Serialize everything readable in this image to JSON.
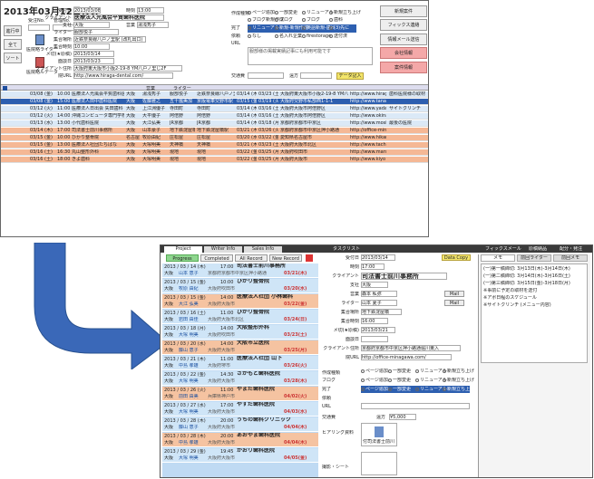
{
  "top": {
    "date": "2013年03月12日(火)",
    "side_buttons": [
      "進行中",
      "全て",
      "ソート"
    ],
    "user_labels": [
      "受注No.",
      "管理No."
    ],
    "icon_labels": [
      "医院略ライター",
      "医院略ルデータ"
    ],
    "fields": [
      {
        "label": "受付日",
        "value": "2013/03/08"
      },
      {
        "label": "時刻",
        "value": "13:00"
      },
      {
        "label": "クライアント",
        "value": "医療法人光風会平賀歯科医院"
      },
      {
        "label": "支社",
        "value": "大阪"
      },
      {
        "label": "営業",
        "value": "湯浅秀子"
      },
      {
        "label": "ライター",
        "value": "服部悦子"
      },
      {
        "label": "集合場所",
        "value": "近鉄奈良線八戸ノ里駅 (改札出口)"
      },
      {
        "label": "集合時刻",
        "value": "10:00"
      },
      {
        "label": "メ切(★原稿)",
        "value": "2013/03/14"
      },
      {
        "label": "面談日",
        "value": "2013/03/23"
      },
      {
        "label": "クライアント住所",
        "value": "大阪府東大阪市小阪2-19-8 YM八戸ノ里じ2F"
      },
      {
        "label": "院URL",
        "value": "http://www.hiraga-dental.com/"
      }
    ],
    "sakusei_label": "作成種類",
    "checkbox_rows": [
      [
        "ページ追加",
        "一部変更",
        "リニューアル",
        "新規立ち上げ"
      ],
      [
        "ブログ新規作成",
        "ブログ",
        "ブログ",
        "歯科"
      ],
      [
        "リニューアル",
        "新規-新規作成",
        "英語新規-歯科",
        "(3)先に"
      ],
      [
        "なし",
        "名入れ企業",
        "firestorage",
        "送付済"
      ]
    ],
    "mid_labels": [
      "完了",
      "依頼",
      "URL"
    ],
    "koutsuuhi": "交通費",
    "tax_label": "遠方",
    "date_btn": "データ記入",
    "note": "服部様の掲載実績記事にも利用可能です",
    "right_buttons": [
      "新規案件",
      "フィックス連絡",
      "情報メール送信",
      "会社情報",
      "案件情報"
    ]
  },
  "grid": {
    "headers": [
      "",
      "営業",
      "ライター"
    ],
    "rows": [
      {
        "date": "03/08 (金)",
        "time": "10:00",
        "client": "医療法人光風会平賀歯科医院",
        "shisha": "大阪",
        "eigyo": "湯浅秀子",
        "writer": "服部悦子",
        "place": "近鉄奈良線八戸ノ里",
        "d1": "03/14 (木)",
        "d2": "03/23 (土)",
        "addr": "大阪府東大阪市小阪2-19-8 YM八戸",
        "url": "http://www.hiraga",
        "note": "歯科医院様の取材",
        "c": "blue"
      },
      {
        "date": "03/08 (金)",
        "time": "15:00",
        "client": "医療法人田中歯科医院",
        "shisha": "大阪",
        "eigyo": "佐藤雅之",
        "writer": "五十嵐美加",
        "place": "京阪電車交野市駅",
        "d1": "03/15 (金)",
        "d2": "03/19 (火)",
        "addr": "大阪府交野市私部西1-1-1",
        "url": "http://www.tanaka",
        "note": "",
        "c": "sel"
      },
      {
        "date": "03/12 (火)",
        "time": "11:00",
        "client": "医療法人日出会 矢田歯科",
        "shisha": "大阪",
        "eigyo": "上江洲優子",
        "writer": "寺田町",
        "place": "寺田町",
        "d1": "03/14 (木)",
        "d2": "03/16 (土)",
        "addr": "大阪府大阪市阿倍野区",
        "url": "http://www.yada",
        "note": "サイトクリンチ",
        "c": "blue"
      },
      {
        "date": "03/12 (火)",
        "time": "14:00",
        "client": "沖縄コンピュータ専門学校",
        "shisha": "大阪",
        "eigyo": "大平優子",
        "writer": "阿倍野",
        "place": "阿倍野",
        "d1": "03/14 (木)",
        "d2": "03/16 (土)",
        "addr": "大阪府大阪市阿倍野区",
        "url": "http://www.okinawa",
        "note": "",
        "c": "blue"
      },
      {
        "date": "03/13 (水)",
        "time": "13:00",
        "client": "小代歯科医院",
        "shisha": "大阪",
        "eigyo": "大江弘美",
        "writer": "JR京都",
        "place": "JR京都",
        "d1": "03/14 (木)",
        "d2": "03/18 (月)",
        "addr": "京都府京都市中京区",
        "url": "http://www.moshiro",
        "note": "最後の医院",
        "c": "blue"
      },
      {
        "date": "03/14 (木)",
        "time": "17:00",
        "client": "司法書士前川事務所",
        "shisha": "大阪",
        "eigyo": "山本豪子",
        "writer": "地下鉄淀屋橋駅",
        "place": "地下鉄淀屋橋駅",
        "d1": "03/21 (木)",
        "d2": "03/26 (火)",
        "addr": "京都府京都市中京区押小路通",
        "url": "http://office-mina",
        "note": "",
        "c": "orange"
      },
      {
        "date": "03/15 (金)",
        "time": "10:00",
        "client": "ひかり整骨院",
        "shisha": "名古屋",
        "eigyo": "牧原由紀",
        "writer": "庄松屋",
        "place": "庄松屋",
        "d1": "03/20 (水)",
        "d2": "03/22 (金)",
        "addr": "愛知県名古屋市",
        "url": "http://www.hikari",
        "note": "",
        "c": "orange"
      },
      {
        "date": "03/15 (金)",
        "time": "13:00",
        "client": "医療法人社団たちばな",
        "shisha": "大阪",
        "eigyo": "大塚明美",
        "writer": "天神橋",
        "place": "天神橋",
        "d1": "03/21 (木)",
        "d2": "03/23 (土)",
        "addr": "大阪府大阪市北区",
        "url": "http://www.tachib",
        "note": "",
        "c": "orange"
      },
      {
        "date": "03/16 (土)",
        "time": "16:30",
        "client": "丸山整形外科",
        "shisha": "大阪",
        "eigyo": "大塚明美",
        "writer": "現地",
        "place": "現地",
        "d1": "03/22 (金)",
        "d2": "03/25 (月)",
        "addr": "大阪府吹田市",
        "url": "http://www.maruy",
        "note": "",
        "c": "orange"
      },
      {
        "date": "03/16 (土)",
        "time": "18:00",
        "client": "きよ歯科",
        "shisha": "大阪",
        "eigyo": "大塚明美",
        "writer": "現地",
        "place": "現地",
        "d1": "03/22 (金)",
        "d2": "03/25 (月)",
        "addr": "大阪府大阪市",
        "url": "http://www.kiyo",
        "note": "",
        "c": "orange"
      }
    ]
  },
  "bottom": {
    "tabs": [
      "Project",
      "Writer Info",
      "Sales Info"
    ],
    "filters": [
      "Progress",
      "Completed",
      "All Record",
      "New Record"
    ],
    "list": [
      {
        "date": "2013 / 03 / 14 (木)",
        "time": "17:00",
        "name": "司法書士前川事務所",
        "s": "大阪",
        "p": "山本 恵子",
        "a": "京都府京都市中京区押小路通",
        "d": "03/21(木)"
      },
      {
        "date": "2013 / 03 / 15 (金)",
        "time": "10:00",
        "name": "ひかり整骨院",
        "s": "大阪",
        "p": "牧原 由紀",
        "a": "大阪府吹田市",
        "d": "03/20(水)"
      },
      {
        "date": "2013 / 03 / 15 (金)",
        "time": "14:00",
        "name": "医療法人社団 小林歯科",
        "s": "大阪",
        "p": "大江 弘美",
        "a": "大阪府大阪市",
        "d": "03/22(金)"
      },
      {
        "date": "2013 / 03 / 16 (土)",
        "time": "11:00",
        "name": "ひかり整骨院",
        "s": "大阪",
        "p": "岩田 由佳",
        "a": "大阪府大阪市北区",
        "d": "03/24(日)"
      },
      {
        "date": "2013 / 03 / 18 (月)",
        "time": "14:00",
        "name": "大阪整形外科",
        "s": "大阪",
        "p": "大塚 明美",
        "a": "大阪府吹田市",
        "d": "03/23(土)"
      },
      {
        "date": "2013 / 03 / 20 (水)",
        "time": "14:00",
        "name": "大阪市立医院",
        "s": "大阪",
        "p": "藤山 恵子",
        "a": "大阪府大阪市",
        "d": "03/25(月)"
      },
      {
        "date": "2013 / 03 / 21 (木)",
        "time": "11:00",
        "name": "医療法人社団 山下",
        "s": "大阪",
        "p": "中島 孝雄",
        "a": "大阪府堺市",
        "d": "03/26(火)"
      },
      {
        "date": "2013 / 03 / 22 (金)",
        "time": "14:30",
        "name": "さかもと歯科医院",
        "s": "大阪",
        "p": "大塚 明美",
        "a": "大阪府大阪市",
        "d": "03/28(木)"
      },
      {
        "date": "2013 / 03 / 26 (火)",
        "time": "11:00",
        "name": "やまだ歯科医院",
        "s": "大阪",
        "p": "前田 由美",
        "a": "兵庫県神戸市",
        "d": "04/02(火)"
      },
      {
        "date": "2013 / 03 / 27 (水)",
        "time": "17:00",
        "name": "やすだ歯科医院",
        "s": "大阪",
        "p": "大塚 明美",
        "a": "大阪府大阪市",
        "d": "04/03(水)"
      },
      {
        "date": "2013 / 03 / 28 (木)",
        "time": "20:00",
        "name": "うちの歯科クリニック",
        "s": "大阪",
        "p": "藤山 恵子",
        "a": "大阪府大阪市",
        "d": "04/04(木)"
      },
      {
        "date": "2013 / 03 / 28 (木)",
        "time": "20:00",
        "name": "あおやま歯科医院",
        "s": "大阪",
        "p": "中島 孝雄",
        "a": "大阪府大阪市",
        "d": "04/04(木)"
      },
      {
        "date": "2013 / 03 / 29 (金)",
        "time": "19:45",
        "name": "かおり歯科医院",
        "s": "大阪",
        "p": "大塚 明美",
        "a": "大阪府大阪市",
        "d": "04/05(金)"
      }
    ],
    "detail_header": "タスクリスト",
    "data_copy": "Data Copy",
    "detail": [
      {
        "label": "受付日",
        "value": "2013/03/14"
      },
      {
        "label": "時刻",
        "value": "17:00"
      },
      {
        "label": "クライアント",
        "value": "司法書士前川事務所"
      },
      {
        "label": "支社",
        "value": "大阪"
      },
      {
        "label": "営業",
        "value": "森本 私弥"
      },
      {
        "label": "ライター",
        "value": "山本 夏子"
      },
      {
        "label": "集合場所",
        "value": "地下鉄淀屋橋"
      },
      {
        "label": "集合時刻",
        "value": "16:00"
      },
      {
        "label": "メ切(★原稿)",
        "value": "2013/03/21"
      },
      {
        "label": "面談日",
        "value": ""
      },
      {
        "label": "クライアント住所",
        "value": "京都府京都市中京区押小路通堀川東入"
      },
      {
        "label": "院URL",
        "value": "http://office-minagawa.com/"
      }
    ],
    "mail_btn": "Mail",
    "check_labels": [
      "作成種類",
      "ブログ",
      "完了",
      "依頼",
      "URL"
    ],
    "check_items": [
      "ページ追加",
      "一部変更",
      "リニューアル",
      "新規立ち上げ"
    ],
    "koutsuuhi": "交通費",
    "tax": "遠方",
    "amount": "¥5,000",
    "hearing": "ヒアリング資料",
    "file_label": "付司法書士前川",
    "photo": "撮影・シート",
    "right_tabs": [
      "フィックスメール",
      "原稿納品",
      "配分・発注"
    ],
    "right_subtabs": [
      "メモ",
      "前回ライター",
      "前回メモ"
    ],
    "right_notes": [
      "(一)第一稿締切: 3月13日(木)-3月14日(木)",
      "(一)第二稿締切: 3月14日(木)-3月16日(土)",
      "(一)第三稿締切: 3月15日(金)-3月18日(月)",
      "※事前に予定の取材を送付",
      "※アポ日程のスケジュール",
      "※サイトクリンチ (メニュー内容)"
    ]
  }
}
